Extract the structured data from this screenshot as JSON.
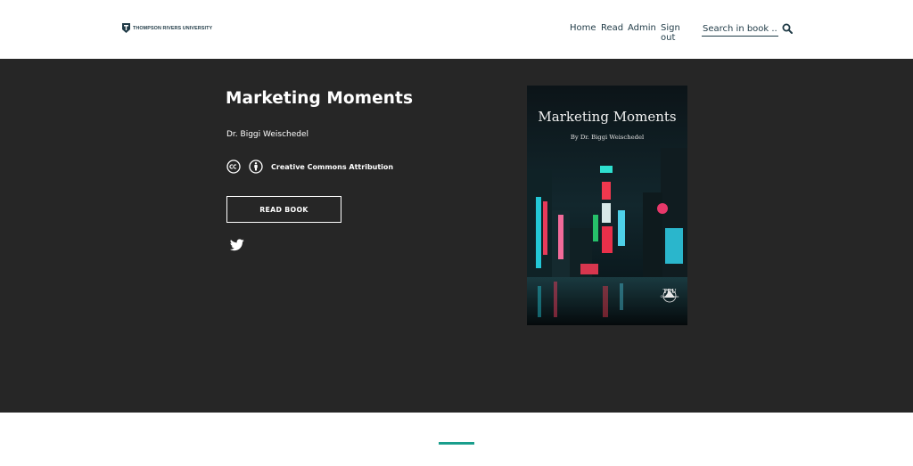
{
  "header": {
    "logo_text": "THOMPSON RIVERS UNIVERSITY",
    "logo_icon": "tru-logo-icon",
    "nav": {
      "home": "Home",
      "read": "Read",
      "admin": "Admin",
      "signout": "Sign out"
    },
    "search": {
      "placeholder": "Search in book ...",
      "icon": "search-icon"
    }
  },
  "book": {
    "title": "Marketing Moments",
    "author": "Dr. Biggi Weischedel",
    "license": {
      "text": "Creative Commons Attribution",
      "icons": [
        "cc-icon",
        "attribution-icon"
      ]
    },
    "read_button": "READ BOOK",
    "share_icon": "twitter-icon"
  },
  "cover": {
    "title": "Marketing Moments",
    "byline": "By Dr. Biggi Weischedel",
    "publisher_short": "TRU",
    "publisher_sub": "Open Press"
  },
  "colors": {
    "hero_bg": "#262626",
    "nav_text": "#1f3a46",
    "accent": "#1a9e8c"
  }
}
